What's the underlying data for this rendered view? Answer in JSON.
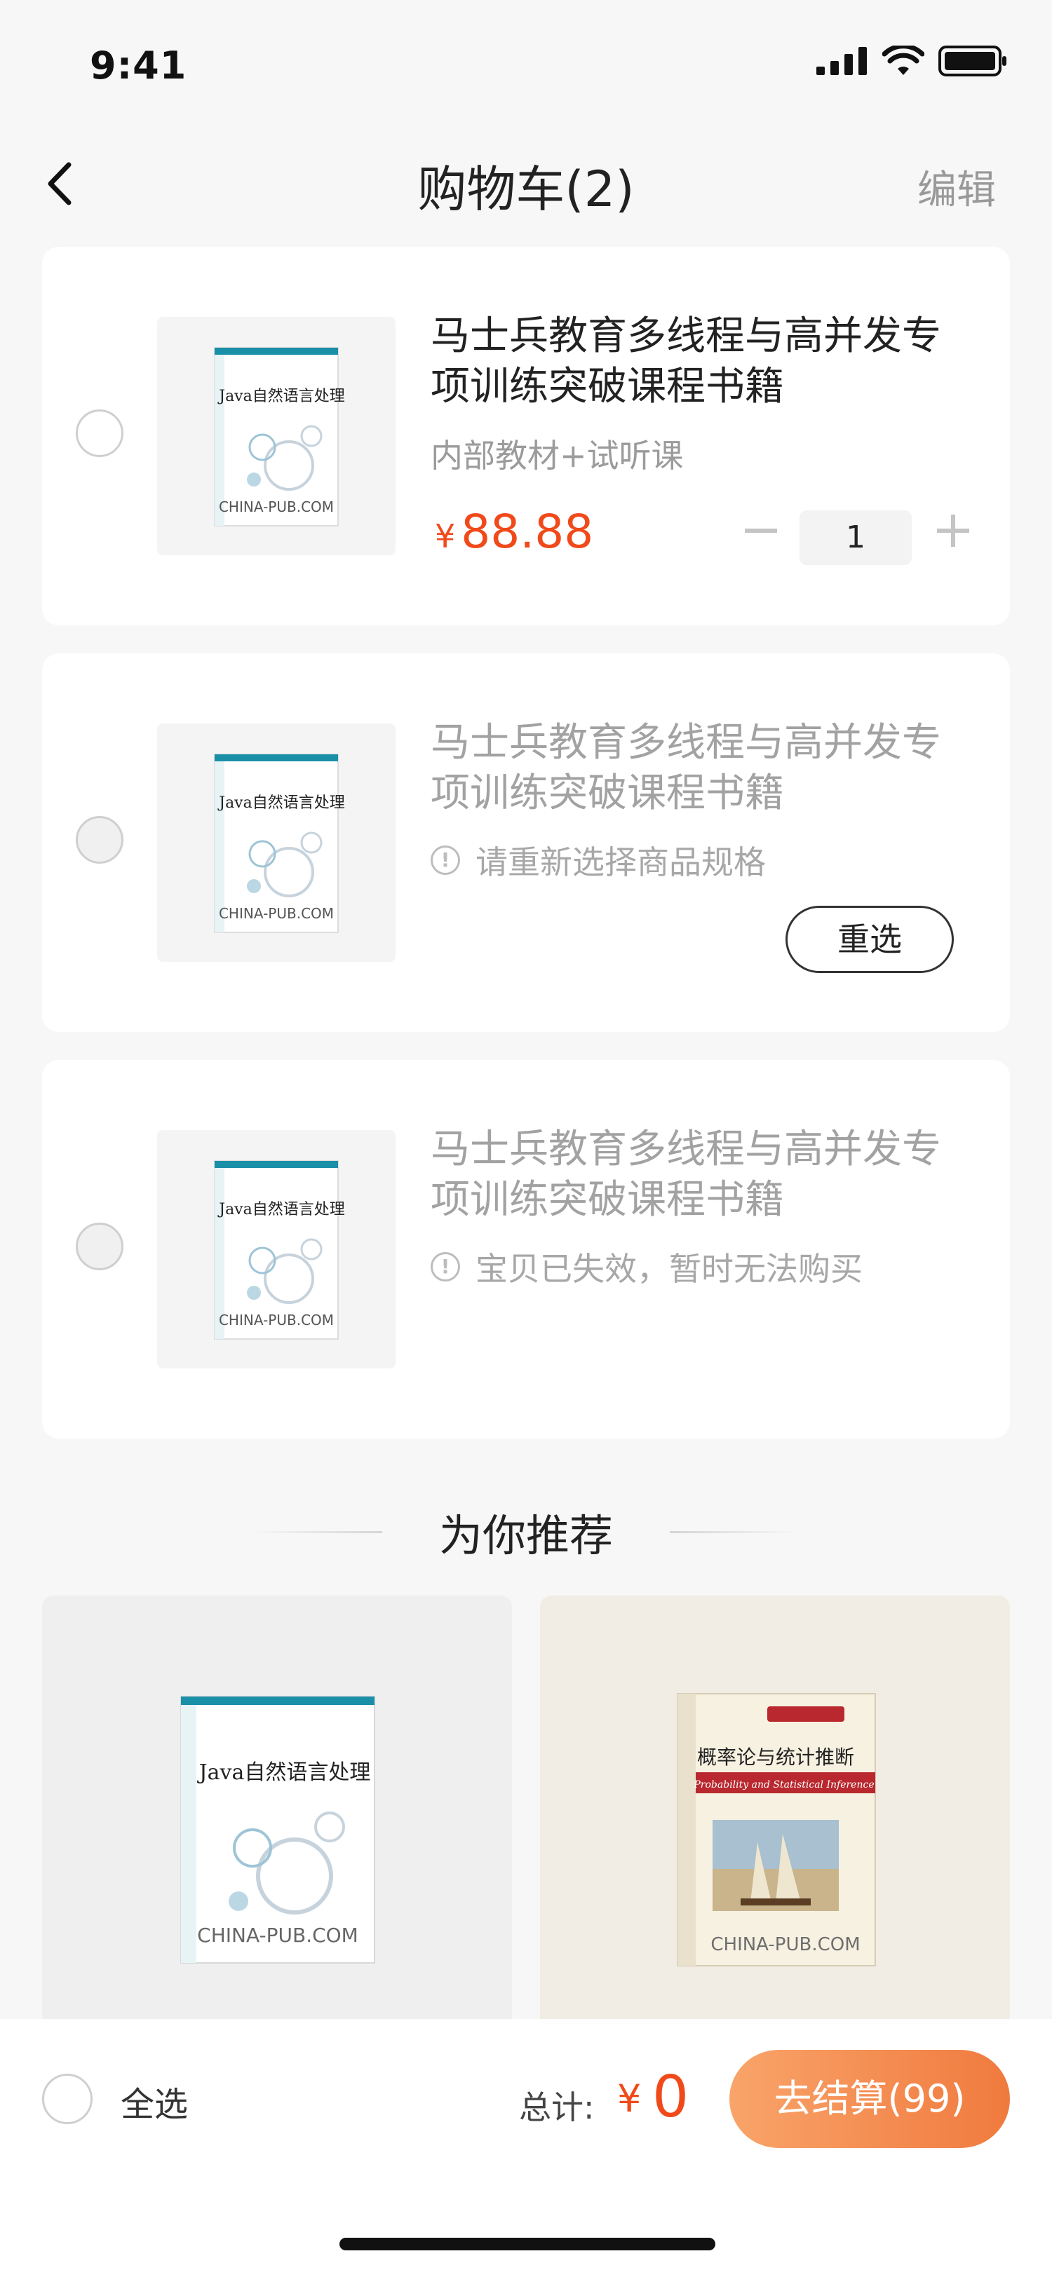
{
  "status_bar": {
    "time": "9:41",
    "icons": [
      "signal-icon",
      "wifi-icon",
      "battery-icon"
    ]
  },
  "nav": {
    "title": "购物车(2)",
    "edit": "编辑",
    "back_icon": "chevron-left-icon"
  },
  "cart_items": [
    {
      "title": "马士兵教育多线程与高并发专项训练突破课程书籍",
      "subtitle": "内部教材+试听课",
      "currency": "¥",
      "price": "88.88",
      "quantity": "1",
      "book_cover": {
        "title": "Java自然语言处理",
        "watermark": "CHINA-PUB.COM"
      }
    },
    {
      "title": "马士兵教育多线程与高并发专项训练突破课程书籍",
      "warning": "请重新选择商品规格",
      "action": "重选",
      "book_cover": {
        "title": "Java自然语言处理",
        "watermark": "CHINA-PUB.COM"
      }
    },
    {
      "title": "马士兵教育多线程与高并发专项训练突破课程书籍",
      "warning": "宝贝已失效，暂时无法购买",
      "book_cover": {
        "title": "Java自然语言处理",
        "watermark": "CHINA-PUB.COM"
      }
    }
  ],
  "recommend": {
    "title": "为你推荐",
    "items": [
      {
        "book_title": "Java自然语言处理",
        "watermark": "CHINA-PUB.COM"
      },
      {
        "book_title": "概率论与统计推断",
        "book_subtitle": "Probability and Statistical Inference",
        "watermark": "CHINA-PUB.COM"
      }
    ]
  },
  "bottom_bar": {
    "select_all": "全选",
    "total_label": "总计:",
    "currency": "¥",
    "total": "0",
    "checkout": "去结算(99)"
  },
  "colors": {
    "accent": "#f04a1b",
    "checkout_start": "#f9a46a",
    "checkout_end": "#f07a3e",
    "background": "#f7f7f7"
  }
}
